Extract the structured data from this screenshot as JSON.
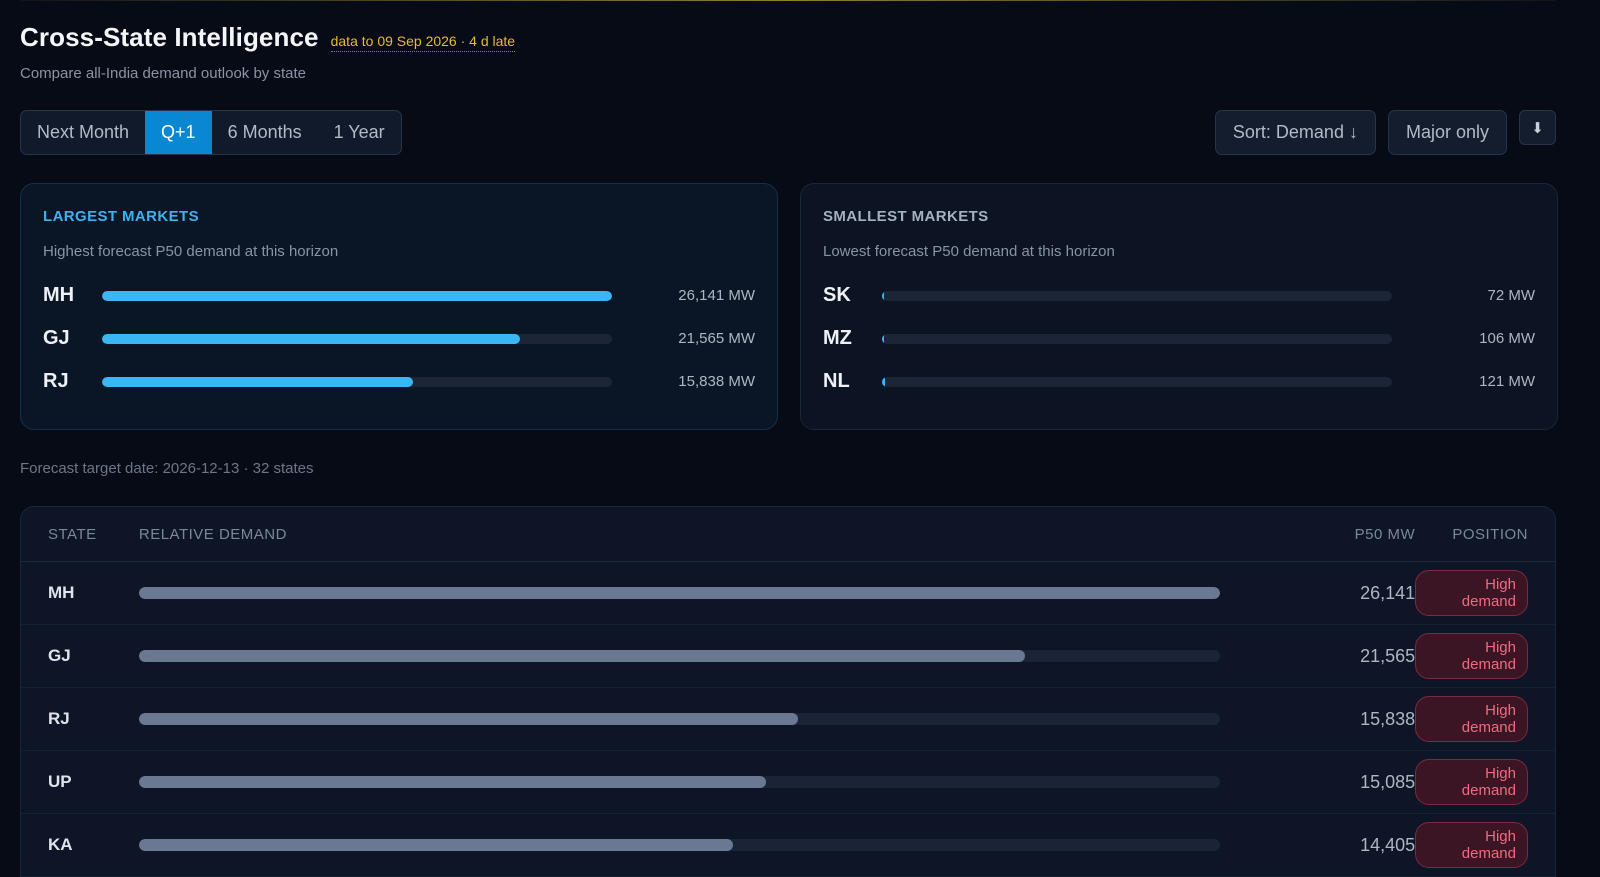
{
  "header": {
    "title": "Cross-State Intelligence",
    "freshness": "data to 09 Sep 2026 · 4 d late",
    "subtitle": "Compare all-India demand outlook by state"
  },
  "horizon_tabs": [
    {
      "label": "Next Month",
      "active": false
    },
    {
      "label": "Q+1",
      "active": true
    },
    {
      "label": "6 Months",
      "active": false
    },
    {
      "label": "1 Year",
      "active": false
    }
  ],
  "controls": {
    "sort_label": "Sort: Demand ↓",
    "filter_label": "Major only",
    "download_glyph": "⬇"
  },
  "largest": {
    "title": "LARGEST MARKETS",
    "subtitle": "Highest forecast P50 demand at this horizon",
    "rows": [
      {
        "state": "MH",
        "value": "26,141 MW",
        "fraction": 1.0
      },
      {
        "state": "GJ",
        "value": "21,565 MW",
        "fraction": 0.82
      },
      {
        "state": "RJ",
        "value": "15,838 MW",
        "fraction": 0.61
      }
    ]
  },
  "smallest": {
    "title": "SMALLEST MARKETS",
    "subtitle": "Lowest forecast P50 demand at this horizon",
    "rows": [
      {
        "state": "SK",
        "value": "72 MW",
        "fraction": 0.003
      },
      {
        "state": "MZ",
        "value": "106 MW",
        "fraction": 0.004
      },
      {
        "state": "NL",
        "value": "121 MW",
        "fraction": 0.005
      }
    ]
  },
  "forecast_meta": "Forecast target date: 2026-12-13 · 32 states",
  "table": {
    "columns": {
      "state": "STATE",
      "bar": "RELATIVE DEMAND",
      "mw": "P50 MW",
      "position": "POSITION"
    },
    "rows": [
      {
        "state": "MH",
        "mw": "26,141",
        "position": "High demand",
        "fraction": 1.0
      },
      {
        "state": "GJ",
        "mw": "21,565",
        "position": "High demand",
        "fraction": 0.82
      },
      {
        "state": "RJ",
        "mw": "15,838",
        "position": "High demand",
        "fraction": 0.61
      },
      {
        "state": "UP",
        "mw": "15,085",
        "position": "High demand",
        "fraction": 0.58
      },
      {
        "state": "KA",
        "mw": "14,405",
        "position": "High demand",
        "fraction": 0.55
      }
    ]
  }
}
